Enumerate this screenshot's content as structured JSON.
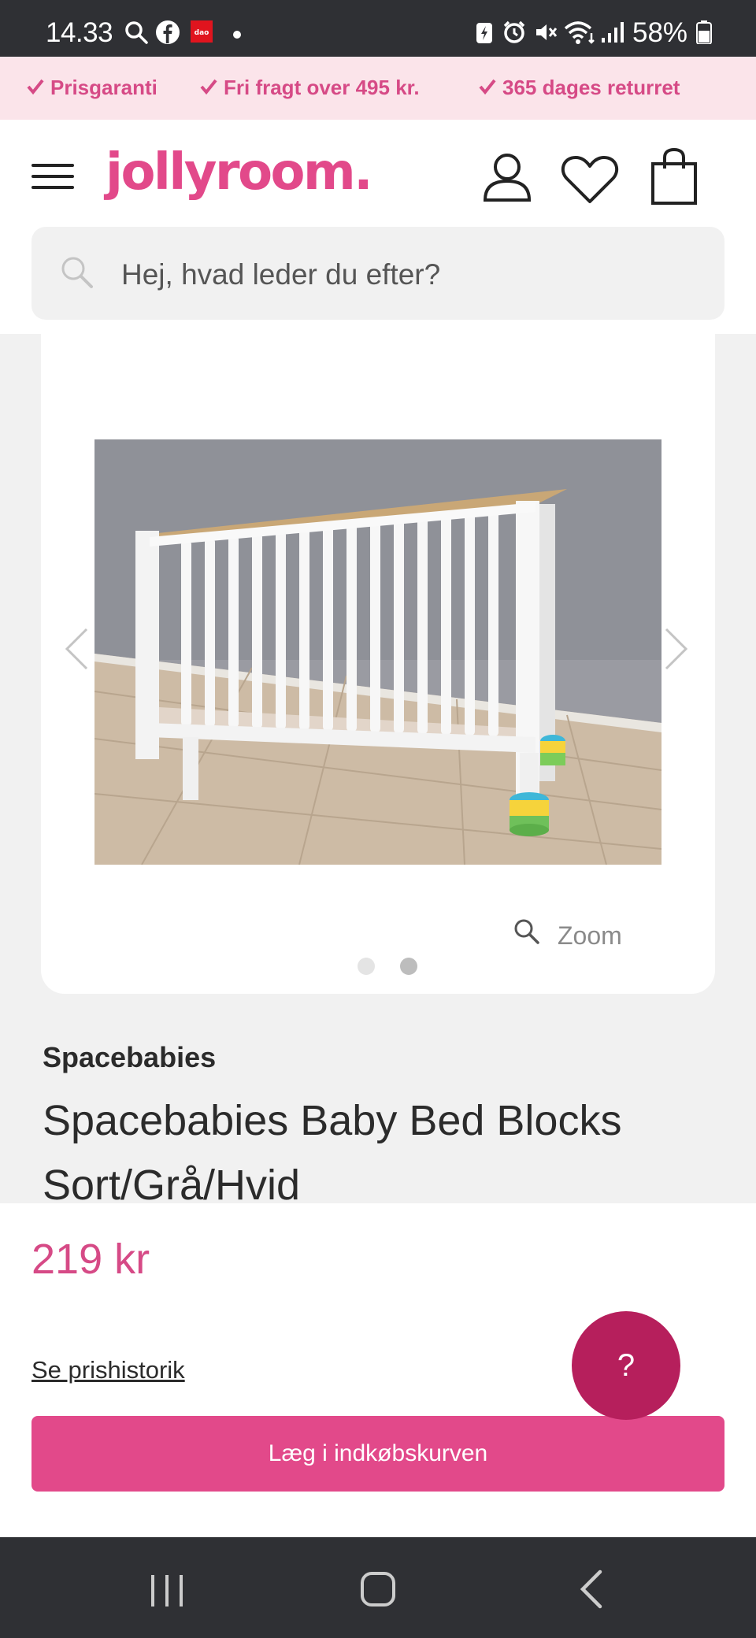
{
  "status_bar": {
    "time": "14.33",
    "battery": "58%"
  },
  "usp": [
    {
      "label": "Prisgaranti"
    },
    {
      "label": "Fri fragt over 495 kr."
    },
    {
      "label": "365 dages returret"
    }
  ],
  "brand_logo": "jollyroom.",
  "search": {
    "placeholder": "Hej, hvad leder du efter?"
  },
  "gallery": {
    "zoom_label": "Zoom",
    "slide_count": 2,
    "active_slide": 2
  },
  "product": {
    "brand": "Spacebabies",
    "title": "Spacebabies Baby Bed Blocks Sort/Grå/Hvid",
    "price": "219 kr",
    "price_history_link": "Se prishistorik",
    "add_to_cart": "Læg i indkøbskurven"
  },
  "help_button": {
    "label": "?"
  },
  "colors": {
    "brand_pink": "#e2498a",
    "help_button": "#b61f5c",
    "usp_background": "#fbe4ea"
  }
}
